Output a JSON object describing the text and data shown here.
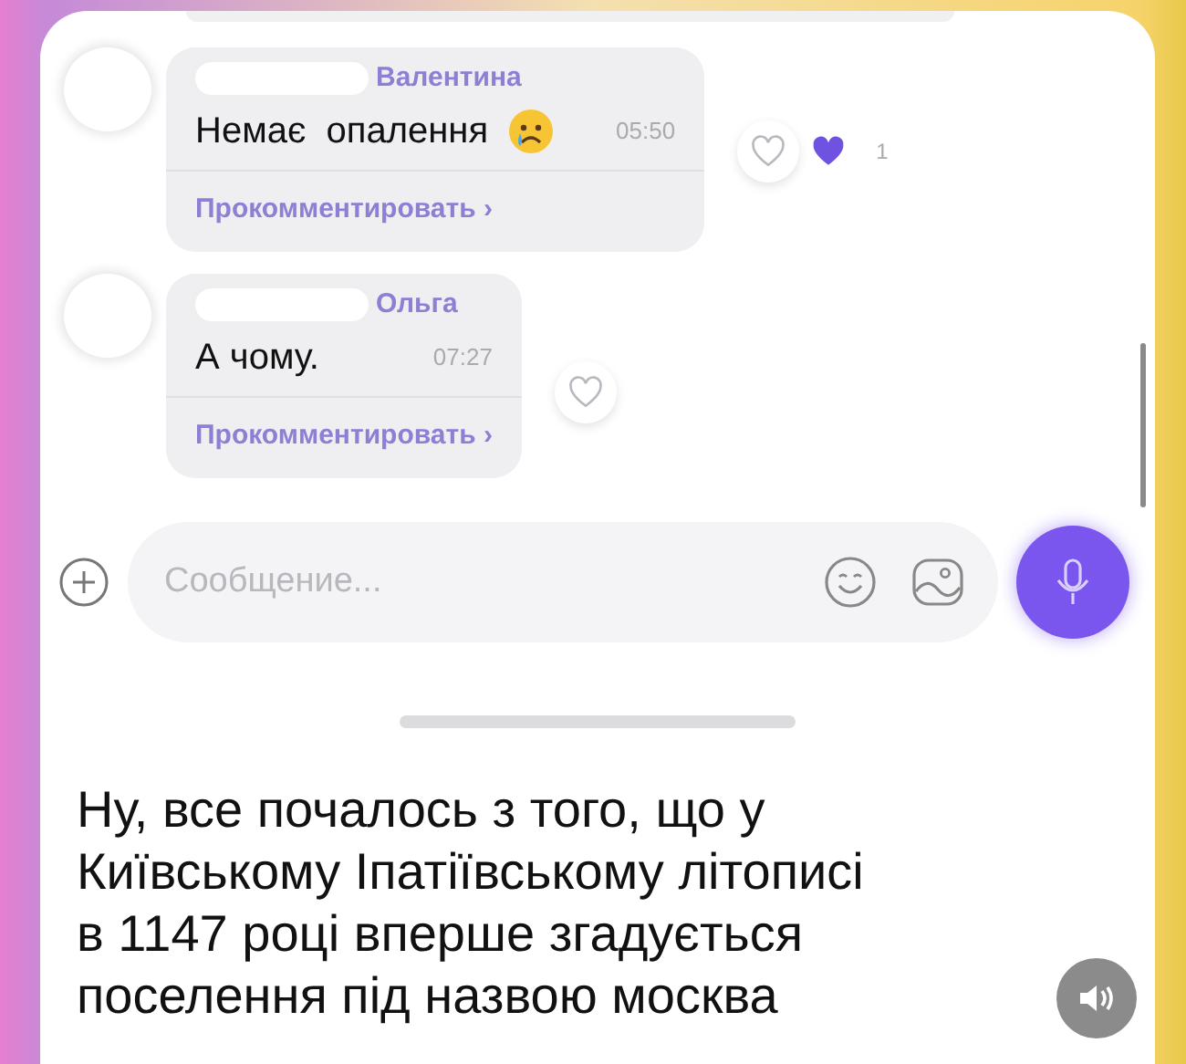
{
  "messages": [
    {
      "author": "Валентина",
      "text": "Немає  опалення",
      "has_emoji": true,
      "time": "05:50",
      "comment_link": "Прокомментировать ›",
      "reaction_count": "1"
    },
    {
      "author": "Ольга",
      "text": "А чому.",
      "has_emoji": false,
      "time": "07:27",
      "comment_link": "Прокомментировать ›"
    }
  ],
  "composer": {
    "placeholder": "Сообщение..."
  },
  "caption_lines": [
    "Ну, все почалось з того, що у",
    "Київському Іпатіївському літописі",
    "в 1147 році вперше згадується",
    "поселення під назвою москва"
  ]
}
